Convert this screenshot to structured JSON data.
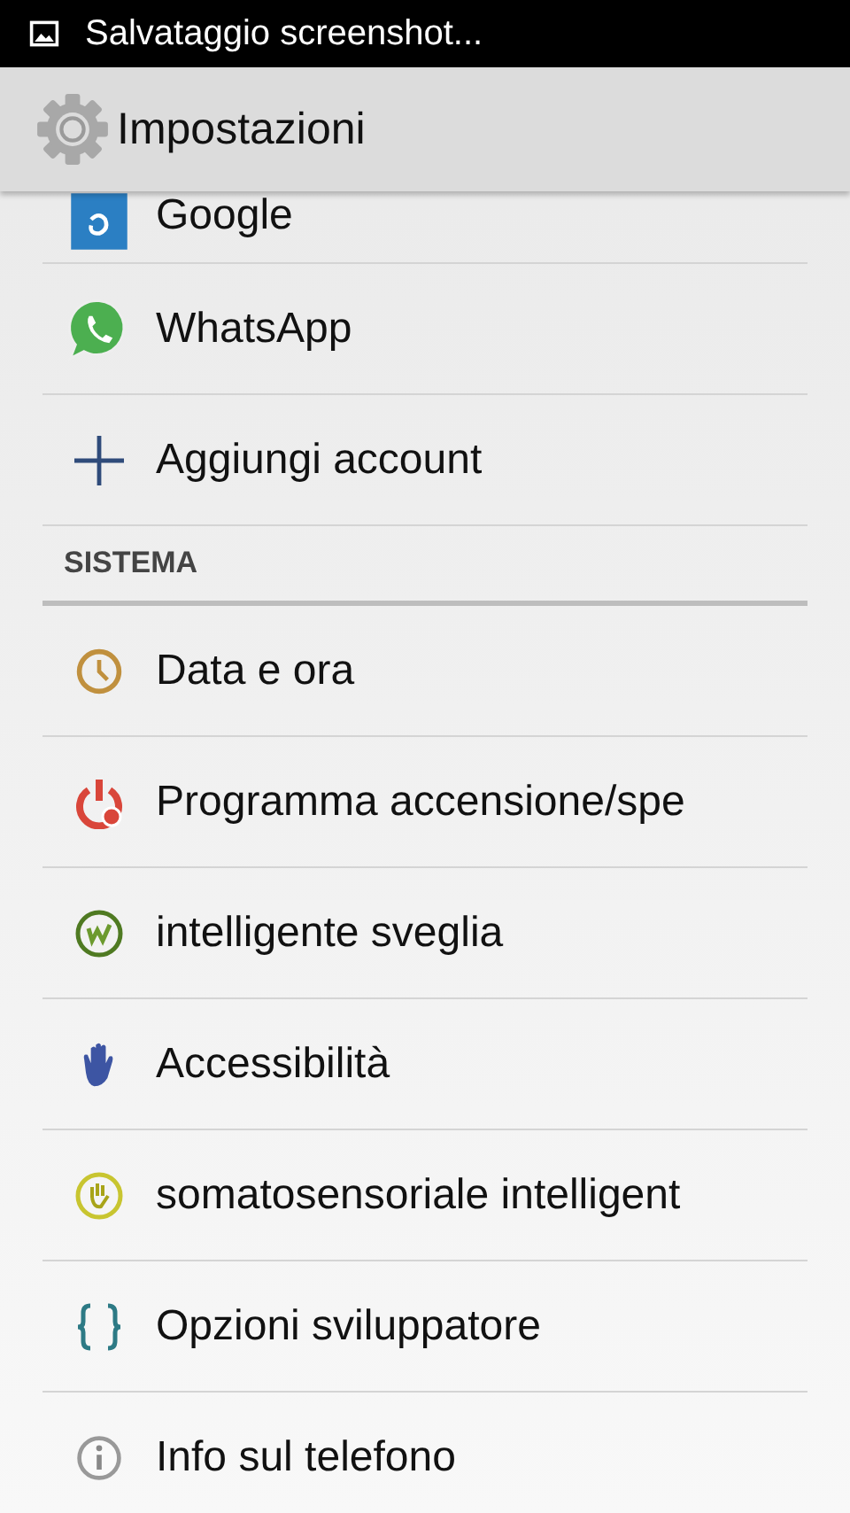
{
  "status_bar": {
    "notification": "Salvataggio screenshot..."
  },
  "action_bar": {
    "title": "Impostazioni"
  },
  "accounts": [
    {
      "kind": "google",
      "label": "Google"
    },
    {
      "kind": "whatsapp",
      "label": "WhatsApp"
    },
    {
      "kind": "add",
      "label": "Aggiungi account"
    }
  ],
  "section_header": "SISTEMA",
  "system_items": [
    {
      "kind": "clock",
      "label": "Data e ora"
    },
    {
      "kind": "power",
      "label": "Programma accensione/spe"
    },
    {
      "kind": "wake",
      "label": "intelligente sveglia"
    },
    {
      "kind": "hand",
      "label": "Accessibilità"
    },
    {
      "kind": "motion",
      "label": "somatosensoriale intelligent"
    },
    {
      "kind": "braces",
      "label": "Opzioni sviluppatore"
    },
    {
      "kind": "info",
      "label": "Info sul telefono"
    }
  ]
}
